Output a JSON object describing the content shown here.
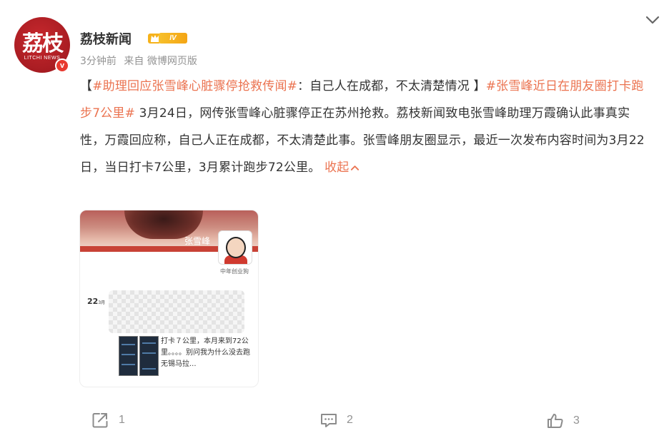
{
  "header": {
    "avatar_text": "荔枝",
    "avatar_sub": "LITCHI NEWS",
    "verified_mark": "v",
    "username": "荔枝新闻",
    "level": "IV",
    "time": "3分钟前",
    "source": "来自 微博网页版"
  },
  "post": {
    "open_bracket": "【",
    "topic1": "#助理回应张雪峰心脏骤停抢救传闻#",
    "headline": "：自己人在成都，不太清楚情况 】",
    "topic2": "#张雪峰近日在朋友圈打卡跑步7公里#",
    "body": " 3月24日，网传张雪峰心脏骤停正在苏州抢救。荔枝新闻致电张雪峰助理万霞确认此事真实性，万霞回应称，自己人正在成都，不太清楚此事。张雪峰朋友圈显示，最近一次发布内容时间为3月22日，当日打卡7公里，3月累计跑步72公里。",
    "collapse_label": "收起"
  },
  "image": {
    "name_tag": "张雪峰",
    "channel": "中年创业狗",
    "date_day": "22",
    "date_month": "3月",
    "post_text": "打卡７公里，本月来到72公里。。。。别问我为什么没去跑无锡马拉..."
  },
  "toolbar": {
    "share_count": "1",
    "comment_count": "2",
    "like_count": "3"
  },
  "colors": {
    "link": "#eb7350",
    "muted": "#939393",
    "brand_red": "#c8292e"
  },
  "icons": [
    "chevron-down-icon",
    "crown-icon",
    "share-icon",
    "comment-icon",
    "like-icon"
  ]
}
